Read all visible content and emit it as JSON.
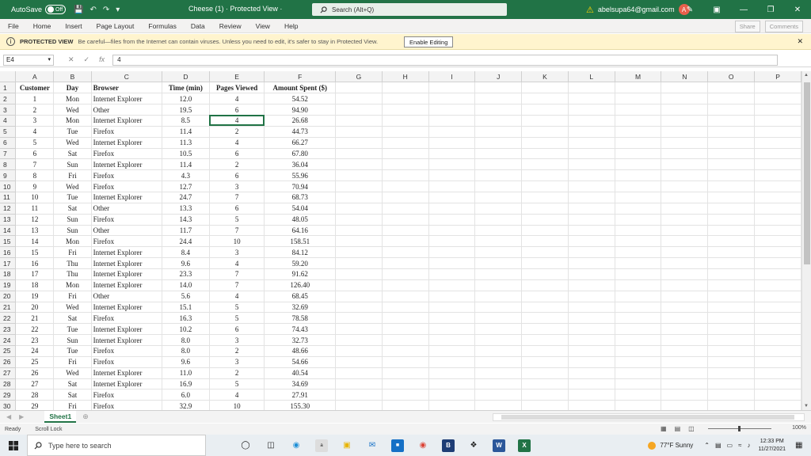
{
  "titlebar": {
    "autosave_label": "AutoSave",
    "autosave_state": "Off",
    "document_title": "Cheese (1)  ·  Protected View ·",
    "search_placeholder": "Search (Alt+Q)",
    "account_email": "abelsupa64@gmail.com",
    "avatar_initial": "A"
  },
  "ribbon": {
    "tabs": [
      "File",
      "Home",
      "Insert",
      "Page Layout",
      "Formulas",
      "Data",
      "Review",
      "View",
      "Help"
    ],
    "share_label": "Share",
    "comments_label": "Comments"
  },
  "protected_view": {
    "title": "PROTECTED VIEW",
    "message": "Be careful—files from the Internet can contain viruses. Unless you need to edit, it's safer to stay in Protected View.",
    "button_label": "Enable Editing"
  },
  "formula_bar": {
    "name_box": "E4",
    "fx_label": "fx",
    "value": "4"
  },
  "grid": {
    "column_letters": [
      "A",
      "B",
      "C",
      "D",
      "E",
      "F",
      "G",
      "H",
      "I",
      "J",
      "K",
      "L",
      "M",
      "N",
      "O",
      "P"
    ],
    "headers": [
      "Customer",
      "Day",
      "Browser",
      "Time (min)",
      "Pages Viewed",
      "Amount Spent ($)"
    ],
    "rows": [
      [
        "1",
        "Mon",
        "Internet Explorer",
        "12.0",
        "4",
        "54.52"
      ],
      [
        "2",
        "Wed",
        "Other",
        "19.5",
        "6",
        "94.90"
      ],
      [
        "3",
        "Mon",
        "Internet Explorer",
        "8.5",
        "4",
        "26.68"
      ],
      [
        "4",
        "Tue",
        "Firefox",
        "11.4",
        "2",
        "44.73"
      ],
      [
        "5",
        "Wed",
        "Internet Explorer",
        "11.3",
        "4",
        "66.27"
      ],
      [
        "6",
        "Sat",
        "Firefox",
        "10.5",
        "6",
        "67.80"
      ],
      [
        "7",
        "Sun",
        "Internet Explorer",
        "11.4",
        "2",
        "36.04"
      ],
      [
        "8",
        "Fri",
        "Firefox",
        "4.3",
        "6",
        "55.96"
      ],
      [
        "9",
        "Wed",
        "Firefox",
        "12.7",
        "3",
        "70.94"
      ],
      [
        "10",
        "Tue",
        "Internet Explorer",
        "24.7",
        "7",
        "68.73"
      ],
      [
        "11",
        "Sat",
        "Other",
        "13.3",
        "6",
        "54.04"
      ],
      [
        "12",
        "Sun",
        "Firefox",
        "14.3",
        "5",
        "48.05"
      ],
      [
        "13",
        "Sun",
        "Other",
        "11.7",
        "7",
        "64.16"
      ],
      [
        "14",
        "Mon",
        "Firefox",
        "24.4",
        "10",
        "158.51"
      ],
      [
        "15",
        "Fri",
        "Internet Explorer",
        "8.4",
        "3",
        "84.12"
      ],
      [
        "16",
        "Thu",
        "Internet Explorer",
        "9.6",
        "4",
        "59.20"
      ],
      [
        "17",
        "Thu",
        "Internet Explorer",
        "23.3",
        "7",
        "91.62"
      ],
      [
        "18",
        "Mon",
        "Internet Explorer",
        "14.0",
        "7",
        "126.40"
      ],
      [
        "19",
        "Fri",
        "Other",
        "5.6",
        "4",
        "68.45"
      ],
      [
        "20",
        "Wed",
        "Internet Explorer",
        "15.1",
        "5",
        "32.69"
      ],
      [
        "21",
        "Sat",
        "Firefox",
        "16.3",
        "5",
        "78.58"
      ],
      [
        "22",
        "Tue",
        "Internet Explorer",
        "10.2",
        "6",
        "74.43"
      ],
      [
        "23",
        "Sun",
        "Internet Explorer",
        "8.0",
        "3",
        "32.73"
      ],
      [
        "24",
        "Tue",
        "Firefox",
        "8.0",
        "2",
        "48.66"
      ],
      [
        "25",
        "Fri",
        "Firefox",
        "9.6",
        "3",
        "54.66"
      ],
      [
        "26",
        "Wed",
        "Internet Explorer",
        "11.0",
        "2",
        "40.54"
      ],
      [
        "27",
        "Sat",
        "Internet Explorer",
        "16.9",
        "5",
        "34.69"
      ],
      [
        "28",
        "Sat",
        "Firefox",
        "6.0",
        "4",
        "27.91"
      ],
      [
        "29",
        "Fri",
        "Firefox",
        "32.9",
        "10",
        "155.30"
      ]
    ],
    "active_cell": "E4"
  },
  "sheet_tabs": {
    "tabs": [
      "Sheet1"
    ],
    "active": "Sheet1"
  },
  "statusbar": {
    "ready": "Ready",
    "scroll_lock": "Scroll Lock",
    "zoom": "100%"
  },
  "taskbar": {
    "search_placeholder": "Type here to search",
    "weather": "77°F  Sunny",
    "time": "12:33 PM",
    "date": "11/27/2021"
  },
  "colors": {
    "excel_green": "#217346",
    "protected_bar": "#fff4ce"
  }
}
